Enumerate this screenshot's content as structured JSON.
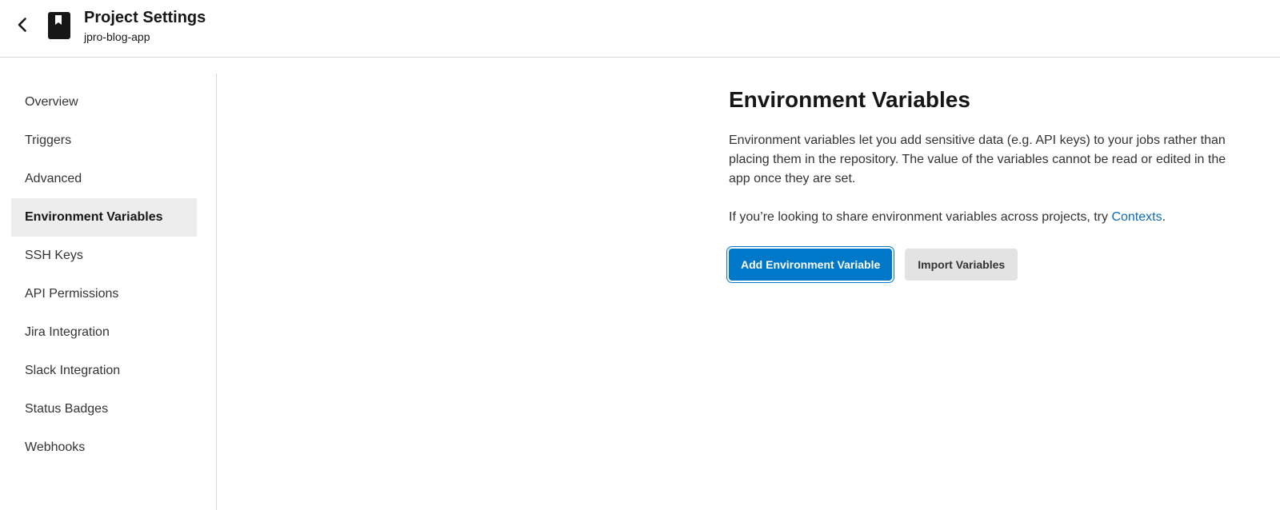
{
  "header": {
    "back_icon": "chevron-left-icon",
    "project_icon": "bookmark-book-icon",
    "title": "Project Settings",
    "subtitle": "jpro-blog-app"
  },
  "sidebar": {
    "items": [
      {
        "label": "Overview",
        "active": false
      },
      {
        "label": "Triggers",
        "active": false
      },
      {
        "label": "Advanced",
        "active": false
      },
      {
        "label": "Environment Variables",
        "active": true
      },
      {
        "label": "SSH Keys",
        "active": false
      },
      {
        "label": "API Permissions",
        "active": false
      },
      {
        "label": "Jira Integration",
        "active": false
      },
      {
        "label": "Slack Integration",
        "active": false
      },
      {
        "label": "Status Badges",
        "active": false
      },
      {
        "label": "Webhooks",
        "active": false
      }
    ]
  },
  "main": {
    "title": "Environment Variables",
    "description": "Environment variables let you add sensitive data (e.g. API keys) to your jobs rather than placing them in the repository. The value of the variables cannot be read or edited in the app once they are set.",
    "hint_text": "If you’re looking to share environment variables across projects, try ",
    "hint_link": "Contexts",
    "hint_suffix": ".",
    "add_button": "Add Environment Variable",
    "import_button": "Import Variables"
  },
  "colors": {
    "primary": "#0078ca",
    "link": "#0e6bb8",
    "active_nav_bg": "#ededed"
  }
}
